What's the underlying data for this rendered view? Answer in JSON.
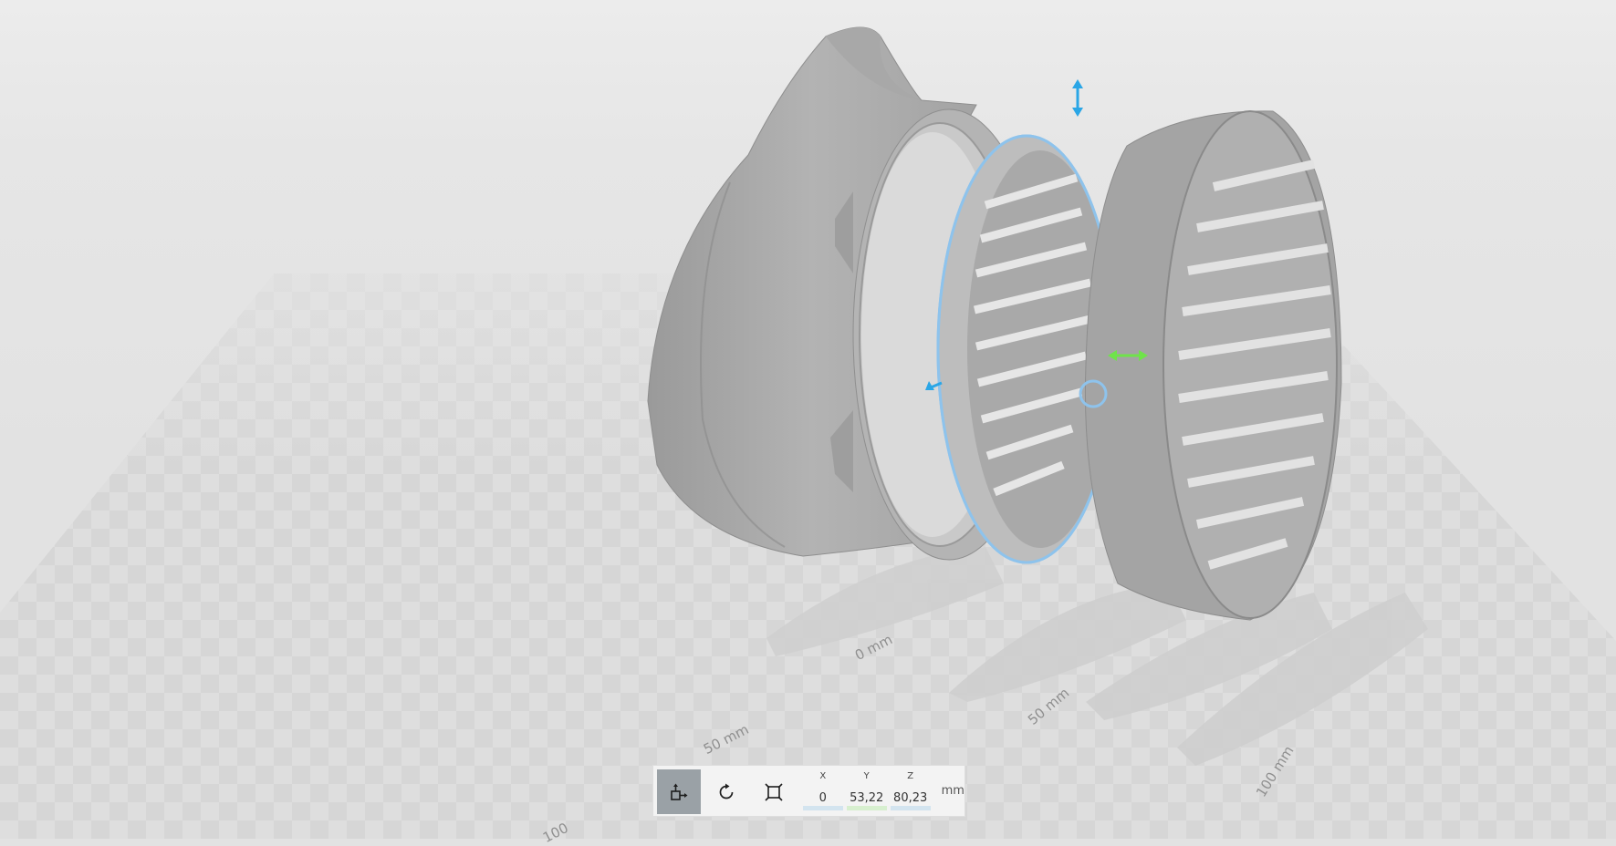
{
  "viewport": {
    "background": "#e2e2e2",
    "selection_color": "#8ec3ec",
    "gizmo_vertical_color": "#2aa6e6",
    "gizmo_horizontal_color": "#6fe34a",
    "gizmo_depth_color": "#2aa6e6"
  },
  "axis_labels": {
    "front_0": "0 mm",
    "front_50": "50 mm",
    "front_100": "100 mm",
    "left_50": "50 mm",
    "left_100": "100"
  },
  "toolbar": {
    "move_icon": "move-icon",
    "rotate_icon": "rotate-icon",
    "scale_icon": "scale-icon",
    "x_label": "X",
    "x_value": "0",
    "y_label": "Y",
    "y_value": "53,22",
    "z_label": "Z",
    "z_value": "80,23",
    "unit": "mm",
    "x_color": "#d3e4ef",
    "y_color": "#d7efcf",
    "z_color": "#d3e4ef",
    "active_color": "#9aa1a6"
  }
}
